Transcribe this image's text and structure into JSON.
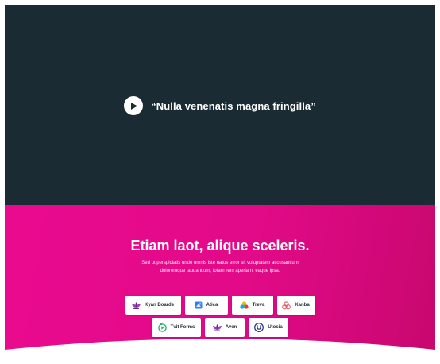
{
  "video": {
    "quote": "“Nulla venenatis magna fringilla”",
    "play_icon": "play-icon"
  },
  "section": {
    "title": "Etiam laot, alique sceleris.",
    "text": "Sed ut perspiciatis unde omnis iste natus error sit voluptatem accusantium doloremque laudantium, totam rem aperiam, eaque ipsa."
  },
  "brands": {
    "row1": [
      {
        "label": "Kyan Boards",
        "icon": "lotus-icon"
      },
      {
        "label": "Atica",
        "icon": "cube-icon"
      },
      {
        "label": "Treva",
        "icon": "petals-icon"
      },
      {
        "label": "Kanba",
        "icon": "rings-icon"
      }
    ],
    "row2": [
      {
        "label": "Tvit Forms",
        "icon": "play-badge-icon"
      },
      {
        "label": "Aven",
        "icon": "lotus-icon"
      },
      {
        "label": "Utosia",
        "icon": "u-circle-icon"
      }
    ]
  },
  "colors": {
    "dark_bg": "#1b2b33",
    "pink_bg": "#e20a88",
    "white": "#ffffff"
  }
}
